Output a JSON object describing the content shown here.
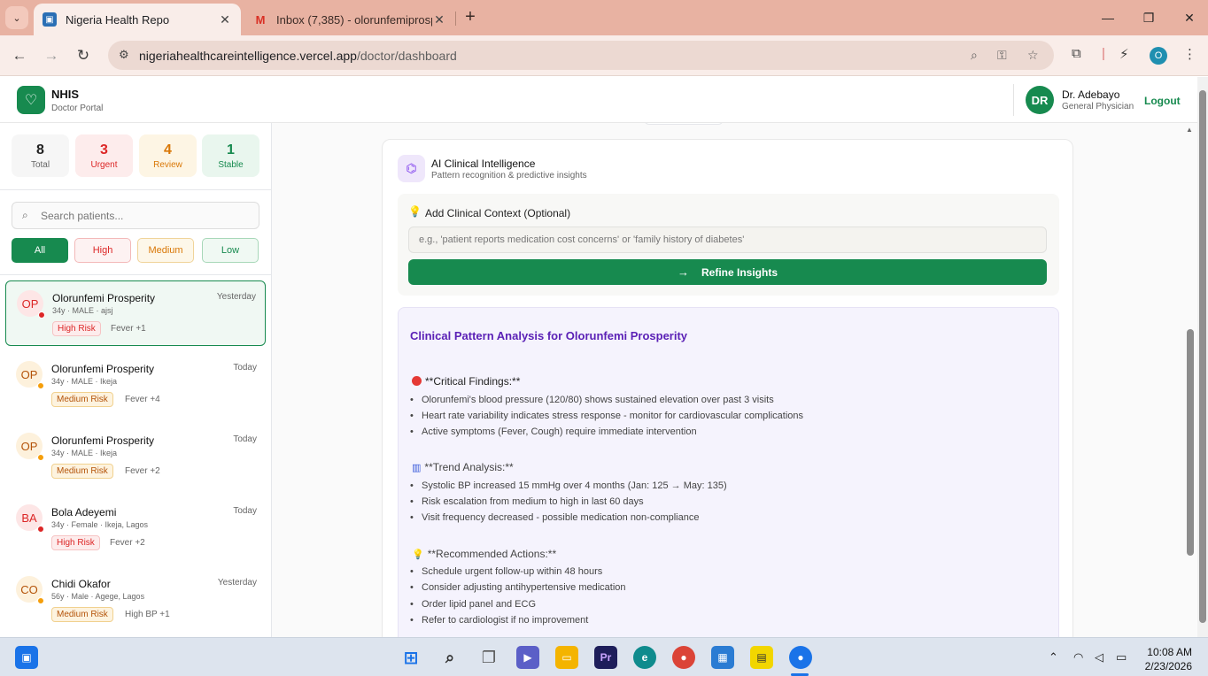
{
  "browser": {
    "tabs": [
      {
        "title": "Nigeria Health Repo",
        "active": true
      },
      {
        "title": "Inbox (7,385) - olorunfemiprosp",
        "active": false
      }
    ],
    "url_host": "nigeriahealthcareintelligence.vercel.app",
    "url_path": "/doctor/dashboard",
    "profile_initial": "O"
  },
  "header": {
    "brand": "NHIS",
    "brand_sub": "Doctor Portal",
    "doctor_initials": "DR",
    "doctor_name": "Dr. Adebayo",
    "doctor_role": "General Physician",
    "logout": "Logout"
  },
  "stats": [
    {
      "num": "8",
      "label": "Total"
    },
    {
      "num": "3",
      "label": "Urgent"
    },
    {
      "num": "4",
      "label": "Review"
    },
    {
      "num": "1",
      "label": "Stable"
    }
  ],
  "search": {
    "placeholder": "Search patients..."
  },
  "filters": [
    "All",
    "High",
    "Medium",
    "Low"
  ],
  "patients": [
    {
      "initials": "OP",
      "name": "Olorunfemi Prosperity",
      "when": "Yesterday",
      "meta": "34y · MALE · ajsj",
      "risk": "High Risk",
      "symptom": "Fever +1"
    },
    {
      "initials": "OP",
      "name": "Olorunfemi Prosperity",
      "when": "Today",
      "meta": "34y · MALE · Ikeja",
      "risk": "Medium Risk",
      "symptom": "Fever +4"
    },
    {
      "initials": "OP",
      "name": "Olorunfemi Prosperity",
      "when": "Today",
      "meta": "34y · MALE · Ikeja",
      "risk": "Medium Risk",
      "symptom": "Fever +2"
    },
    {
      "initials": "BA",
      "name": "Bola Adeyemi",
      "when": "Today",
      "meta": "34y · Female · Ikeja, Lagos",
      "risk": "High Risk",
      "symptom": "Fever +2"
    },
    {
      "initials": "CO",
      "name": "Chidi Okafor",
      "when": "Yesterday",
      "meta": "56y · Male · Agege, Lagos",
      "risk": "Medium Risk",
      "symptom": "High BP +1"
    }
  ],
  "ai": {
    "title": "AI Clinical Intelligence",
    "subtitle": "Pattern recognition & predictive insights",
    "context_label": "Add Clinical Context (Optional)",
    "context_placeholder": "e.g., 'patient reports medication cost concerns' or 'family history of diabetes'",
    "refine_label": "Refine Insights",
    "analysis_title": "Clinical Pattern Analysis for Olorunfemi Prosperity",
    "critical_heading": "**Critical Findings:**",
    "critical": [
      "Olorunfemi's blood pressure (120/80) shows sustained elevation over past 3 visits",
      "Heart rate variability indicates stress response - monitor for cardiovascular complications",
      "Active symptoms (Fever, Cough) require immediate intervention"
    ],
    "trend_heading": "**Trend Analysis:**",
    "trend": [
      "Systolic BP increased 15 mmHg over 4 months (Jan: 125 → May: 135)",
      "Risk escalation from medium to high in last 60 days",
      "Visit frequency decreased - possible medication non-compliance"
    ],
    "actions_heading": "**Recommended Actions:**",
    "actions": [
      "Schedule urgent follow-up within 48 hours",
      "Consider adjusting antihypertensive medication",
      "Order lipid panel and ECG",
      "Refer to cardiologist if no improvement"
    ]
  },
  "taskbar": {
    "time": "10:08 AM",
    "date": "2/23/2026"
  },
  "colors": {
    "brand_green": "#178a4f",
    "high_risk": "#dc2626",
    "medium_risk": "#d97706",
    "analysis_purple": "#5b21b6"
  }
}
